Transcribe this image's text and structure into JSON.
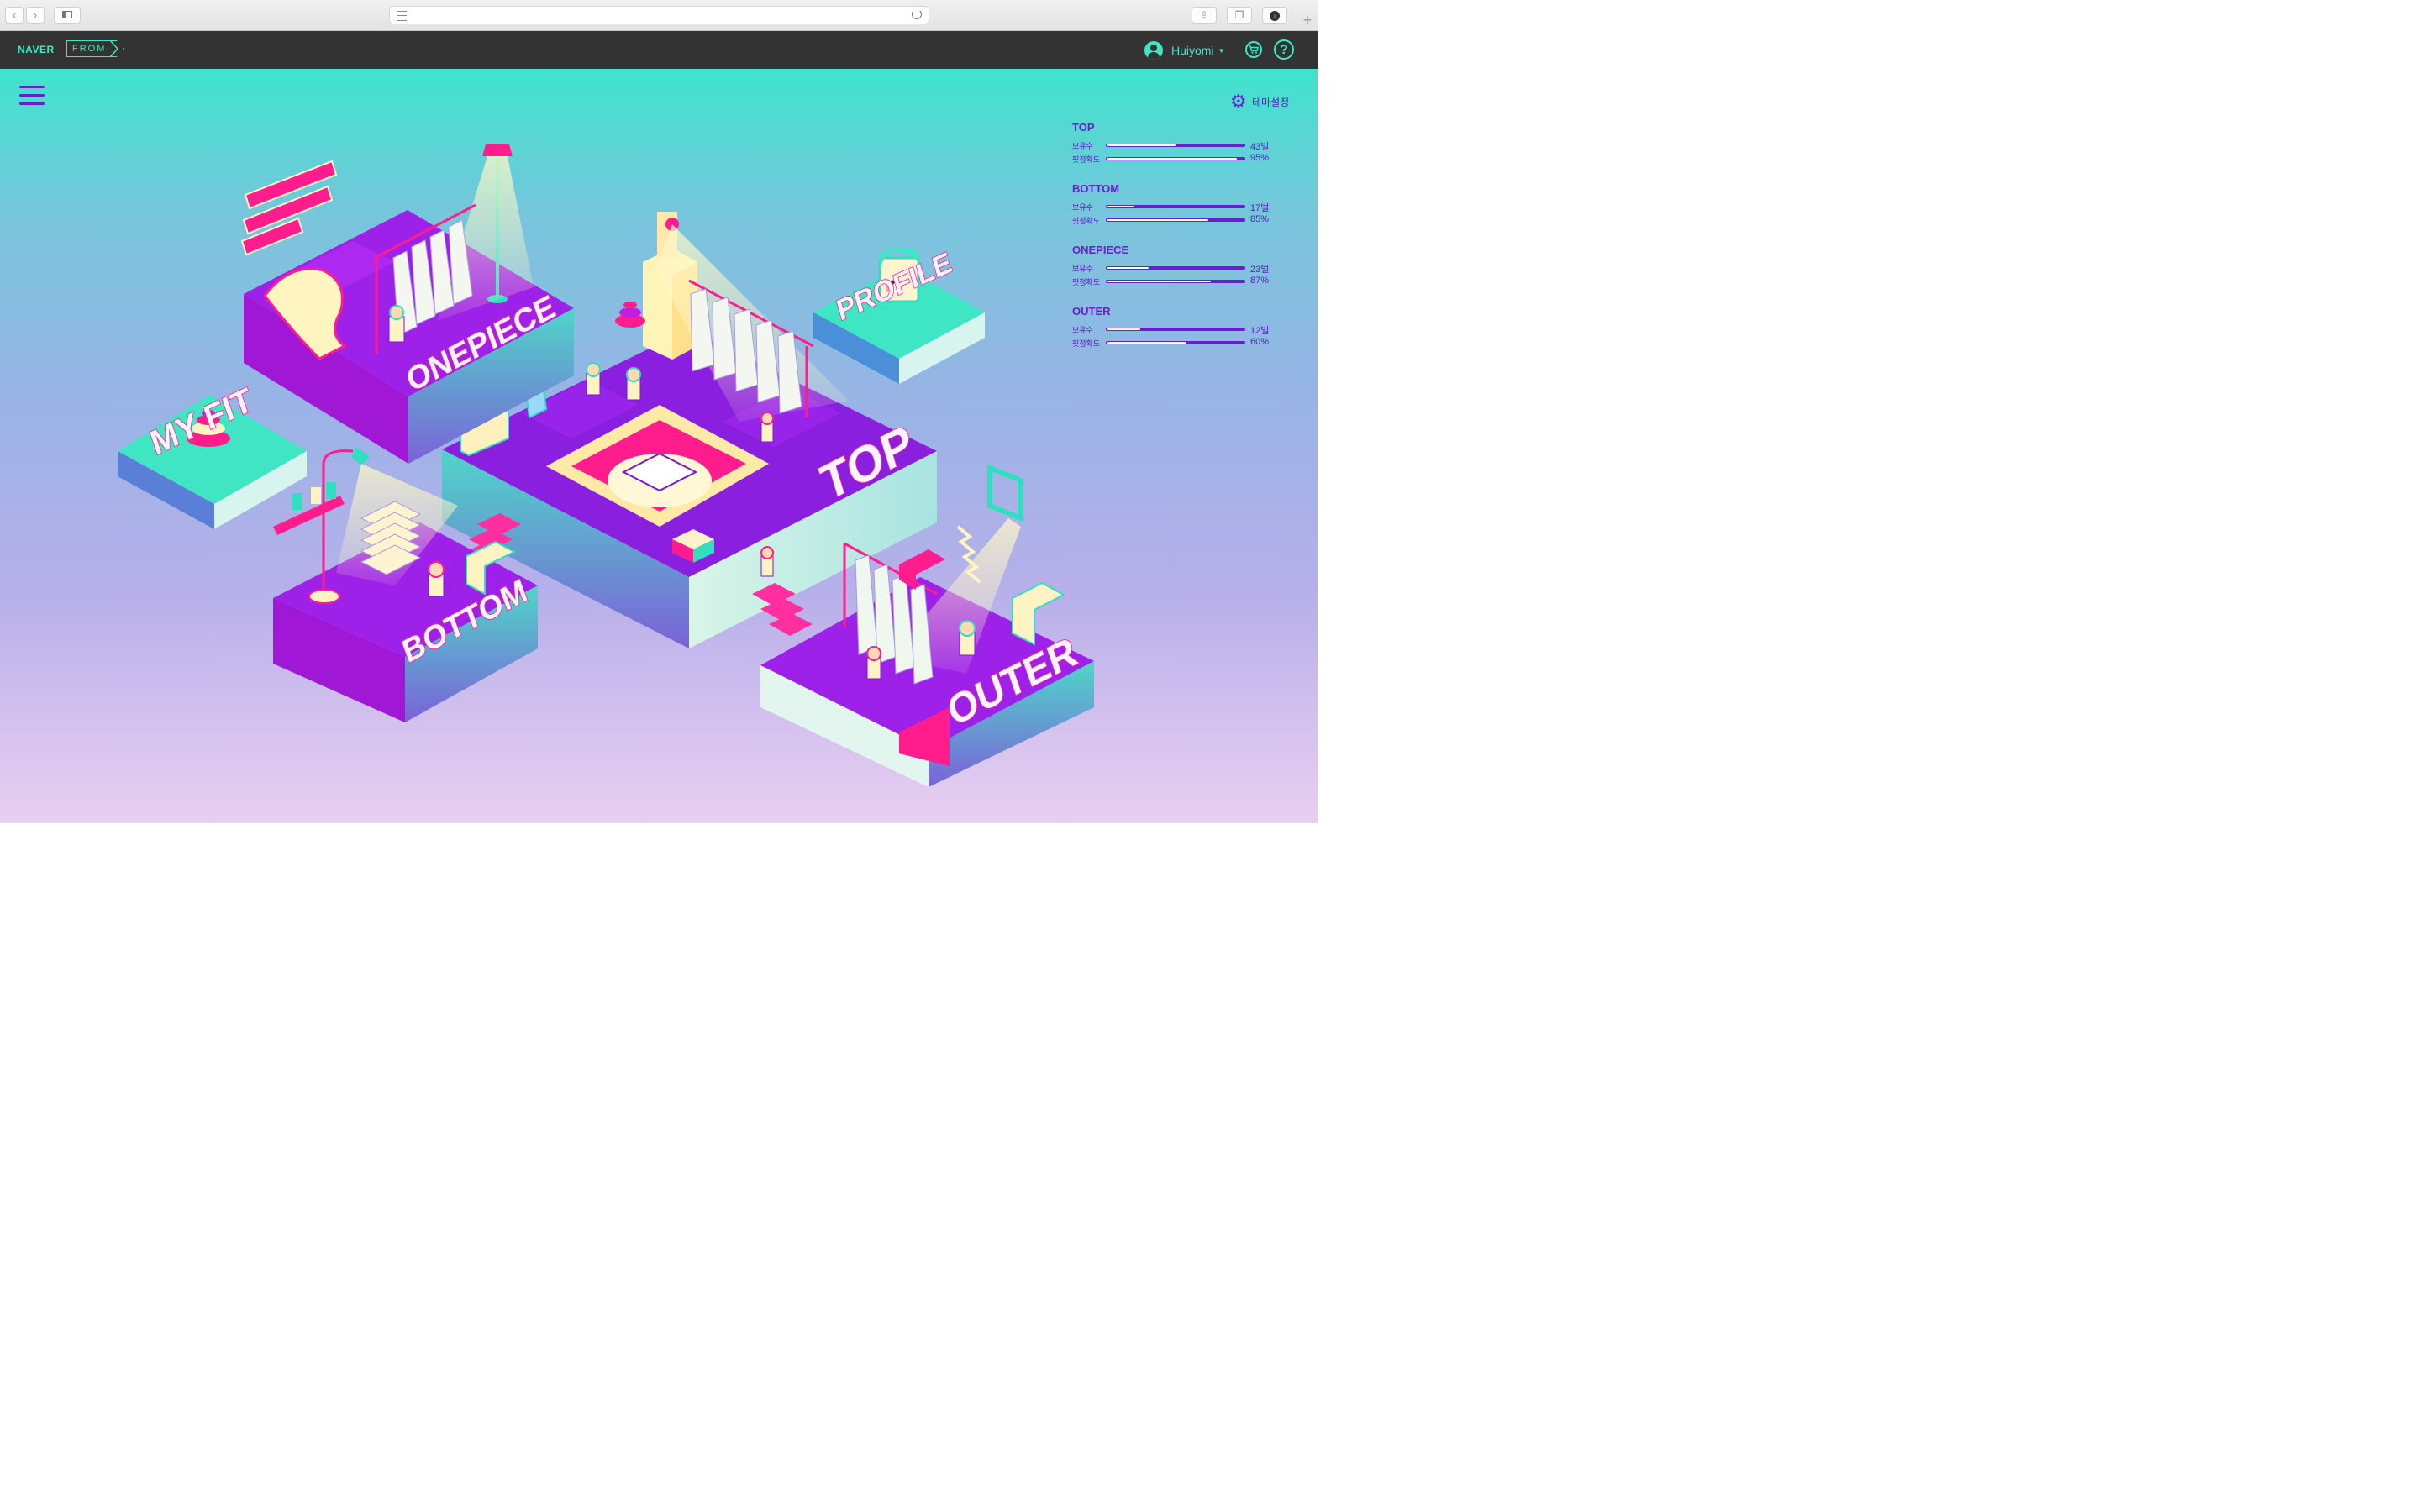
{
  "browser": {
    "nav_back": "‹",
    "nav_forward": "›",
    "new_tab": "+"
  },
  "header": {
    "naver": "NAVER",
    "from": "FROM·",
    "username": "Huiyomi",
    "cart_icon": "cart-icon",
    "help": "?"
  },
  "theme_settings": "테마설정",
  "rooms": {
    "onepiece": "ONEPIECE",
    "top": "TOP",
    "profile": "PROFILE",
    "myfit": "MY FIT",
    "bottom": "BOTTOM",
    "outer": "OUTER"
  },
  "stats": [
    {
      "title": "TOP",
      "owned_label": "보유수",
      "owned_value": "43벌",
      "owned_level": 0.5,
      "fit_label": "핏정확도",
      "fit_value": "95%",
      "fit_level": 0.95
    },
    {
      "title": "BOTTOM",
      "owned_label": "보유수",
      "owned_value": "17벌",
      "owned_level": 0.19,
      "fit_label": "핏정확도",
      "fit_value": "85%",
      "fit_level": 0.74
    },
    {
      "title": "ONEPIECE",
      "owned_label": "보유수",
      "owned_value": "23벌",
      "owned_level": 0.3,
      "fit_label": "핏정확도",
      "fit_value": "87%",
      "fit_level": 0.76
    },
    {
      "title": "OUTER",
      "owned_label": "보유수",
      "owned_value": "12벌",
      "owned_level": 0.24,
      "fit_label": "핏정확도",
      "fit_value": "60%",
      "fit_level": 0.58
    }
  ],
  "colors": {
    "accent": "#3ce8c4",
    "purple": "#7a16d8",
    "pink": "#ff1d8e",
    "cream": "#fff3c4"
  }
}
